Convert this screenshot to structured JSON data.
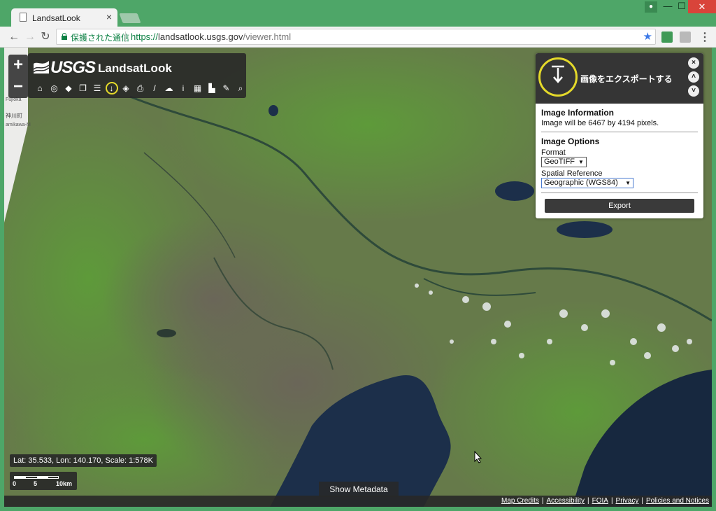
{
  "browser": {
    "tab_title": "LandsatLook",
    "tab_close": "×",
    "secure_label": "保護された通信",
    "url_scheme": "https://",
    "url_host": "landsatlook.usgs.gov",
    "url_path": "/viewer.html"
  },
  "window": {
    "user_icon": "person-icon",
    "min": "—",
    "max": "☐",
    "close": "✕"
  },
  "nav": {
    "back": "←",
    "forward": "→",
    "reload": "↻",
    "star": "★",
    "menu": "⋮"
  },
  "app": {
    "logo_text": "USGS",
    "title": "LandsatLook",
    "zoom_in": "+",
    "zoom_out": "−",
    "tools": [
      {
        "name": "home-tool",
        "glyph": "⌂"
      },
      {
        "name": "locate-tool",
        "glyph": "◎"
      },
      {
        "name": "tag-tool",
        "glyph": "◆"
      },
      {
        "name": "layers-copy-tool",
        "glyph": "❐"
      },
      {
        "name": "adjust-tool",
        "glyph": "☰"
      },
      {
        "name": "export-tool",
        "glyph": "↓"
      },
      {
        "name": "stack-tool",
        "glyph": "◈"
      },
      {
        "name": "print-tool",
        "glyph": "⎙"
      },
      {
        "name": "measure-tool",
        "glyph": "/"
      },
      {
        "name": "chat-tool",
        "glyph": "☁"
      },
      {
        "name": "info-tool",
        "glyph": "i"
      },
      {
        "name": "pages-tool",
        "glyph": "▦"
      },
      {
        "name": "bookmark-tool",
        "glyph": "▙"
      },
      {
        "name": "edit-tool",
        "glyph": "✎"
      },
      {
        "name": "search-tool",
        "glyph": "⌕"
      }
    ],
    "active_tool": "export-tool"
  },
  "export_panel": {
    "title": "画像をエクスポートする",
    "close": "×",
    "up": "˄",
    "down": "˅",
    "info_heading": "Image Information",
    "info_text": "Image will be 6467 by 4194 pixels.",
    "options_heading": "Image Options",
    "format_label": "Format",
    "format_value": "GeoTIFF",
    "spatial_label": "Spatial Reference",
    "spatial_value": "Geographic (WGS84)",
    "caret": "▼",
    "export_button": "Export"
  },
  "map": {
    "coords": "Lat: 35.533, Lon: 140.170, Scale: 1:578K",
    "scale_labels": [
      "0",
      "5",
      "10km"
    ],
    "show_metadata": "Show Metadata",
    "left_labels": [
      "Fujioka",
      "神川町",
      "amikawa-M"
    ]
  },
  "footer": {
    "links": [
      "Map Credits",
      "Accessibility",
      "FOIA",
      "Privacy",
      "Policies and Notices"
    ]
  },
  "colors": {
    "chrome_green": "#4ea668",
    "accent_yellow": "#e4d92a",
    "panel_dark": "#353535",
    "water": "#1c2f4a"
  }
}
